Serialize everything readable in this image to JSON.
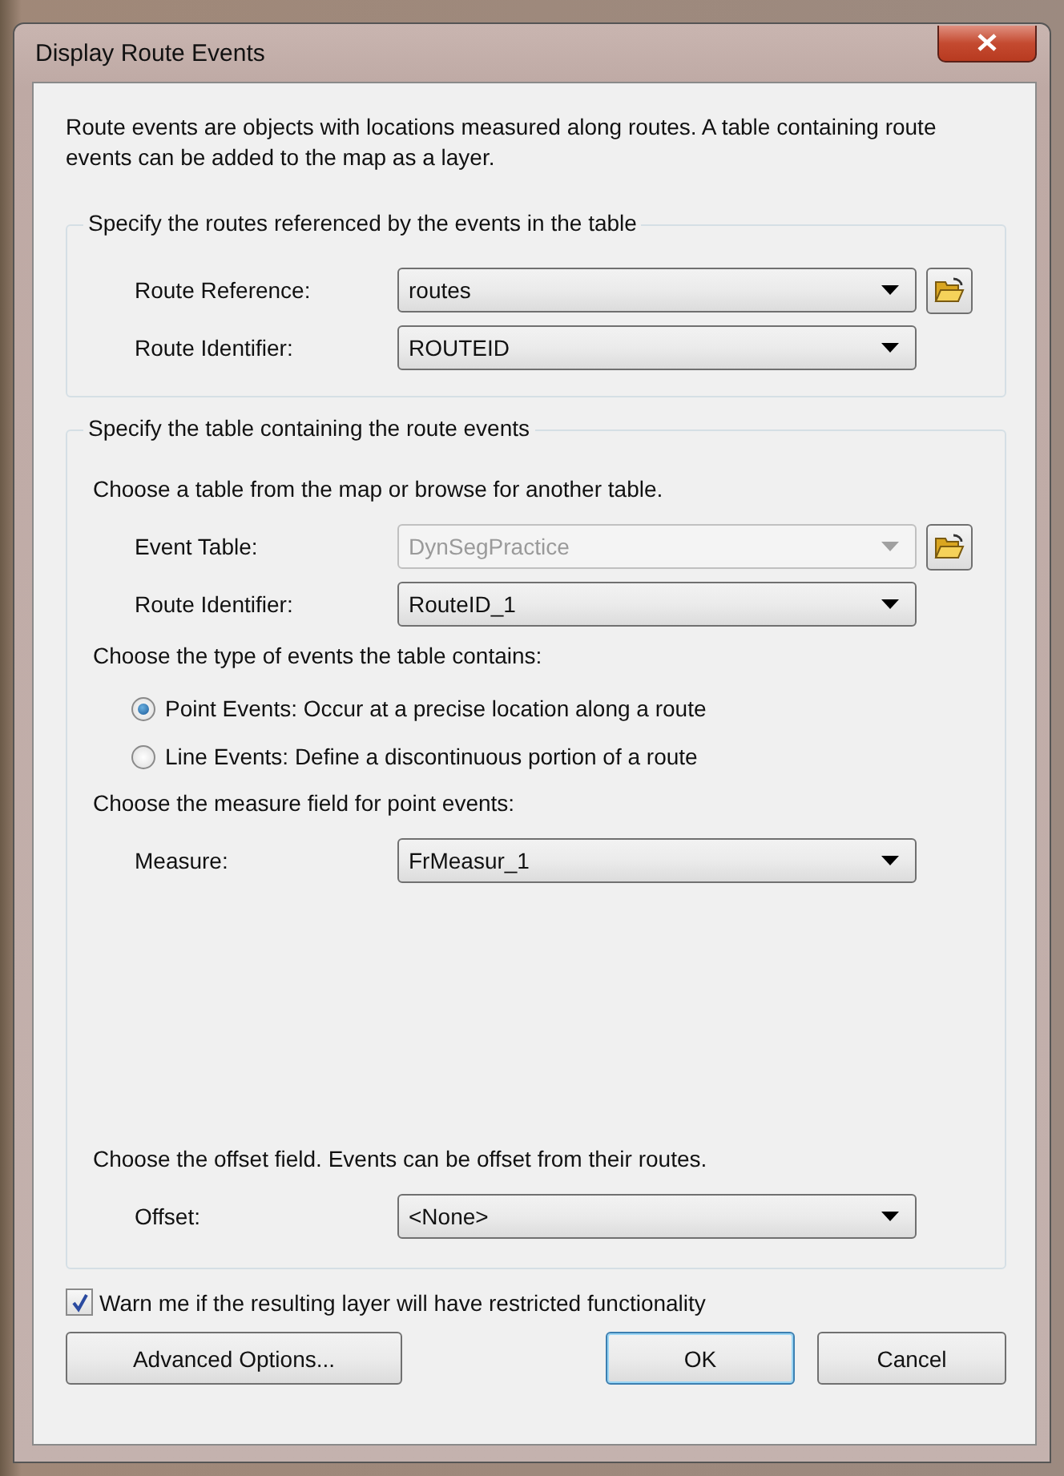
{
  "window": {
    "title": "Display Route Events"
  },
  "description": "Route events are objects with locations measured along routes. A table containing route events can be added to the map as a layer.",
  "groups": [
    {
      "legend": "Specify the routes referenced by the events in the table",
      "blocks": [
        {
          "items": [
            {
              "kind": "field",
              "label": "Route Reference:",
              "value": "routes",
              "disabled": false,
              "browse": true
            },
            {
              "kind": "field",
              "label": "Route Identifier:",
              "value": "ROUTEID",
              "disabled": false,
              "browse": false
            }
          ]
        }
      ]
    },
    {
      "legend": "Specify the table containing the route events",
      "blocks": [
        {
          "prompt": "Choose a table from the map or browse for another table.",
          "items": [
            {
              "kind": "field",
              "label": "Event Table:",
              "value": "DynSegPractice",
              "disabled": true,
              "browse": true
            },
            {
              "kind": "field",
              "label": "Route Identifier:",
              "value": "RouteID_1",
              "disabled": false,
              "browse": false
            }
          ]
        },
        {
          "prompt": "Choose the type of events the table contains:",
          "items": [
            {
              "kind": "radio",
              "label": "Point Events: Occur at a precise location along a route",
              "selected": true
            },
            {
              "kind": "radio",
              "label": "Line Events: Define a discontinuous portion of a route",
              "selected": false
            }
          ]
        },
        {
          "prompt": "Choose the measure field for point events:",
          "items": [
            {
              "kind": "field",
              "label": "Measure:",
              "value": "FrMeasur_1",
              "disabled": false,
              "browse": false
            }
          ]
        },
        {
          "prompt": "Choose the offset field. Events can be offset from their routes.",
          "items": [
            {
              "kind": "field",
              "label": "Offset:",
              "value": "<None>",
              "disabled": false,
              "browse": false
            }
          ]
        }
      ]
    }
  ],
  "warning_checkbox": {
    "label": "Warn me if the resulting layer will have restricted functionality",
    "checked": true
  },
  "buttons": [
    {
      "label": "Advanced Options...",
      "default": false
    },
    {
      "label": "OK",
      "default": true
    },
    {
      "label": "Cancel",
      "default": false
    }
  ]
}
